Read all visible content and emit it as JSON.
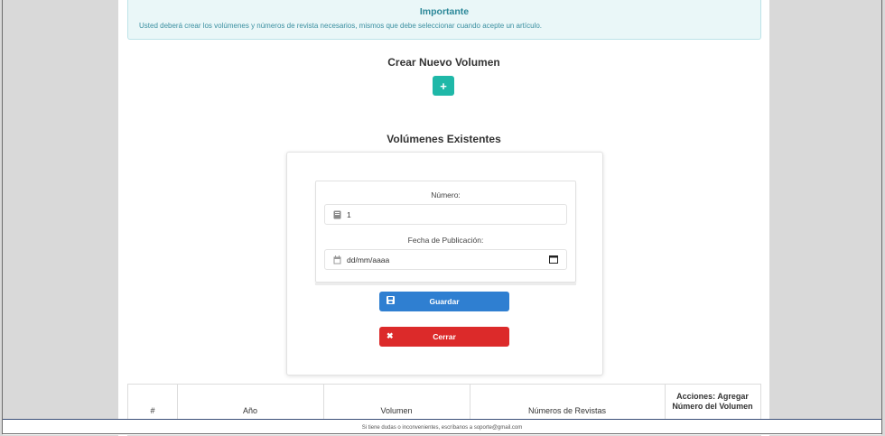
{
  "alert": {
    "title": "Importante",
    "body": "Usted deberá crear los volúmenes y números de revista necesarios, mismos que debe seleccionar cuando acepte un artículo."
  },
  "create_section": {
    "title": "Crear Nuevo Volumen",
    "add_icon": "plus-icon"
  },
  "existing_section": {
    "title": "Volúmenes Existentes"
  },
  "form": {
    "numero_label": "Número:",
    "numero_value": "1",
    "numero_icon": "book-icon",
    "fecha_label": "Fecha de Publicación:",
    "fecha_placeholder": "dd/mm/aaaa",
    "fecha_icon": "calendar-icon",
    "save_label": "Guardar",
    "save_icon": "floppy-disk-icon",
    "close_label": "Cerrar",
    "close_icon": "times-icon"
  },
  "table": {
    "headers": [
      "#",
      "Año",
      "Volumen",
      "Números de Revistas",
      "Acciones: Agregar Número del Volumen"
    ]
  },
  "footer": {
    "text": "Si tiene dudas o inconvenientes, escríbanos a soporte@gmail.com"
  },
  "colors": {
    "accent_teal": "#1fb8a8",
    "save_blue": "#2f7fd1",
    "close_red": "#dc2a2a",
    "alert_text": "#2b8798"
  }
}
